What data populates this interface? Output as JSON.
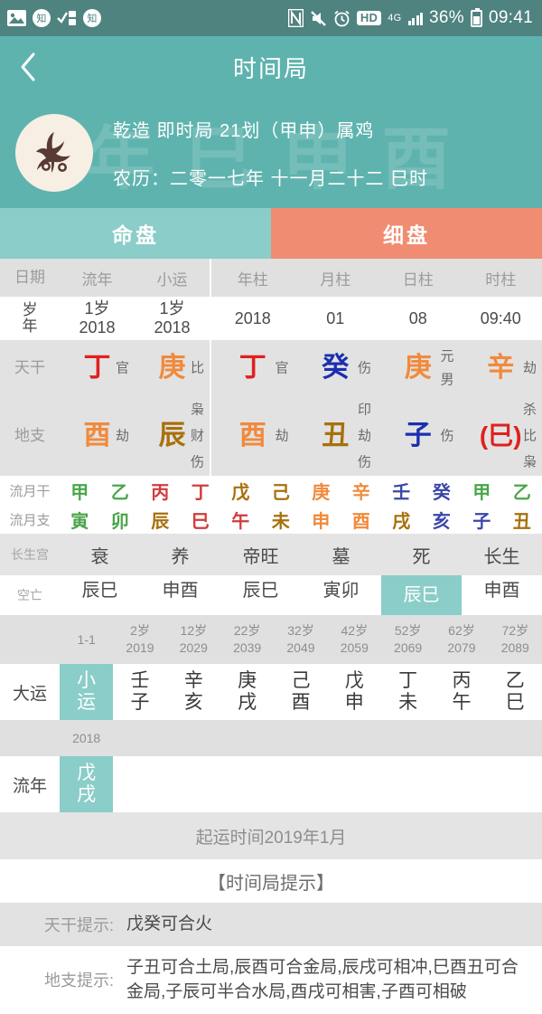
{
  "statusbar": {
    "icons_left": [
      "image-icon",
      "notify-icon",
      "task-icon",
      "notify2-icon"
    ],
    "nfc": "N",
    "mute": "mute-icon",
    "alarm": "alarm-icon",
    "hd": "HD",
    "network": "4G",
    "signal": "signal-icon",
    "battery_pct": "36%",
    "time": "09:41"
  },
  "titlebar": {
    "back": "back-icon",
    "title": "时间局"
  },
  "banner": {
    "avatar": "rooster-avatar",
    "watermark": "年 巳 申 酉",
    "line1": "乾造  即时局  21划（甲申）属鸡",
    "line2": "农历：二零一七年 十一月二十二 巳时"
  },
  "tabs": [
    {
      "label": "命盘",
      "active": true,
      "color": "#8bcdc8"
    },
    {
      "label": "细盘",
      "active": false,
      "color": "#f08c72"
    }
  ],
  "left_panel": {
    "headers": [
      "日期",
      "流年",
      "小运"
    ],
    "date_row": {
      "label_top": "岁",
      "label_bottom": "年",
      "liunian_age": "1岁",
      "liunian_year": "2018",
      "xiaoyun_age": "1岁",
      "xiaoyun_year": "2018"
    },
    "tiangan": {
      "label": "天干",
      "cells": [
        {
          "char": "丁",
          "color": "#e02020",
          "gods": [
            "官"
          ]
        },
        {
          "char": "庚",
          "color": "#f08a3c",
          "gods": [
            "比"
          ]
        }
      ]
    },
    "dizhi": {
      "label": "地支",
      "cells": [
        {
          "char": "酉",
          "color": "#f08a3c",
          "gods": [
            "劫"
          ]
        },
        {
          "char": "辰",
          "color": "#a8700c",
          "gods": [
            "枭",
            "财",
            "伤"
          ]
        }
      ]
    }
  },
  "right_panel": {
    "headers": [
      "年柱",
      "月柱",
      "日柱",
      "时柱"
    ],
    "date_values": [
      "2018",
      "01",
      "08",
      "09:40"
    ],
    "tiangan": {
      "cells": [
        {
          "char": "丁",
          "color": "#e02020",
          "gods": [
            "官"
          ]
        },
        {
          "char": "癸",
          "color": "#1a2fb0",
          "gods": [
            "伤"
          ]
        },
        {
          "char": "庚",
          "color": "#f08a3c",
          "gods": [
            "元",
            "男"
          ]
        },
        {
          "char": "辛",
          "color": "#f08a3c",
          "gods": [
            "劫"
          ]
        }
      ]
    },
    "dizhi": {
      "cells": [
        {
          "char": "酉",
          "color": "#f08a3c",
          "gods": [
            "劫"
          ]
        },
        {
          "char": "丑",
          "color": "#a8700c",
          "gods": [
            "印",
            "劫",
            "伤"
          ]
        },
        {
          "char": "子",
          "color": "#1a2fb0",
          "gods": [
            "伤"
          ]
        },
        {
          "char": "(巳)",
          "color": "#e02020",
          "gods": [
            "杀",
            "比",
            "枭"
          ]
        }
      ]
    }
  },
  "liuyue": {
    "gan_label": "流月干",
    "zhi_label": "流月支",
    "gan": [
      {
        "c": "甲",
        "color": "#49a649"
      },
      {
        "c": "乙",
        "color": "#49a649"
      },
      {
        "c": "丙",
        "color": "#d33b3b"
      },
      {
        "c": "丁",
        "color": "#d33b3b"
      },
      {
        "c": "戊",
        "color": "#a8700c"
      },
      {
        "c": "己",
        "color": "#a8700c"
      },
      {
        "c": "庚",
        "color": "#f08a3c"
      },
      {
        "c": "辛",
        "color": "#f08a3c"
      },
      {
        "c": "壬",
        "color": "#3a46a8"
      },
      {
        "c": "癸",
        "color": "#3a46a8"
      },
      {
        "c": "甲",
        "color": "#49a649"
      },
      {
        "c": "乙",
        "color": "#49a649"
      }
    ],
    "zhi": [
      {
        "c": "寅",
        "color": "#49a649"
      },
      {
        "c": "卯",
        "color": "#49a649"
      },
      {
        "c": "辰",
        "color": "#a8700c"
      },
      {
        "c": "巳",
        "color": "#d33b3b"
      },
      {
        "c": "午",
        "color": "#d33b3b"
      },
      {
        "c": "未",
        "color": "#a8700c"
      },
      {
        "c": "申",
        "color": "#f08a3c"
      },
      {
        "c": "酉",
        "color": "#f08a3c"
      },
      {
        "c": "戌",
        "color": "#a8700c"
      },
      {
        "c": "亥",
        "color": "#3a46a8"
      },
      {
        "c": "子",
        "color": "#3a46a8"
      },
      {
        "c": "丑",
        "color": "#a8700c"
      }
    ]
  },
  "changsheng": {
    "label": "长生宫",
    "values": [
      "衰",
      "养",
      "帝旺",
      "墓",
      "死",
      "长生"
    ]
  },
  "kongwang": {
    "label": "空亡",
    "values": [
      "辰巳",
      "申酉",
      "辰巳",
      "寅卯",
      "辰巳",
      "申酉"
    ],
    "highlight_index": 4
  },
  "dayun": {
    "label": "大运",
    "columns": [
      {
        "age": "1-1",
        "year": "",
        "gan": "小",
        "zhi": "运",
        "highlight": true
      },
      {
        "age": "2岁",
        "year": "2019",
        "gan": "壬",
        "zhi": "子",
        "highlight": false
      },
      {
        "age": "12岁",
        "year": "2029",
        "gan": "辛",
        "zhi": "亥",
        "highlight": false
      },
      {
        "age": "22岁",
        "year": "2039",
        "gan": "庚",
        "zhi": "戌",
        "highlight": false
      },
      {
        "age": "32岁",
        "year": "2049",
        "gan": "己",
        "zhi": "酉",
        "highlight": false
      },
      {
        "age": "42岁",
        "year": "2059",
        "gan": "戊",
        "zhi": "申",
        "highlight": false
      },
      {
        "age": "52岁",
        "year": "2069",
        "gan": "丁",
        "zhi": "未",
        "highlight": false
      },
      {
        "age": "62岁",
        "year": "2079",
        "gan": "丙",
        "zhi": "午",
        "highlight": false
      },
      {
        "age": "72岁",
        "year": "2089",
        "gan": "乙",
        "zhi": "巳",
        "highlight": false
      }
    ]
  },
  "liunian": {
    "label": "流年",
    "columns": [
      {
        "year": "2018",
        "gan": "戊",
        "zhi": "戌",
        "highlight": true
      },
      {
        "year": "",
        "gan": "",
        "zhi": "",
        "highlight": false
      },
      {
        "year": "",
        "gan": "",
        "zhi": "",
        "highlight": false
      },
      {
        "year": "",
        "gan": "",
        "zhi": "",
        "highlight": false
      },
      {
        "year": "",
        "gan": "",
        "zhi": "",
        "highlight": false
      },
      {
        "year": "",
        "gan": "",
        "zhi": "",
        "highlight": false
      },
      {
        "year": "",
        "gan": "",
        "zhi": "",
        "highlight": false
      },
      {
        "year": "",
        "gan": "",
        "zhi": "",
        "highlight": false
      },
      {
        "year": "",
        "gan": "",
        "zhi": "",
        "highlight": false
      }
    ]
  },
  "qiyun": "起运时间2019年1月",
  "tips": {
    "title": "【时间局提示】",
    "tiangan_label": "天干提示:",
    "tiangan_value": "戊癸可合火",
    "dizhi_label": "地支提示:",
    "dizhi_value": "子丑可合土局,辰酉可合金局,辰戌可相冲,巳酉丑可合金局,子辰可半合水局,酉戌可相害,子酉可相破"
  }
}
